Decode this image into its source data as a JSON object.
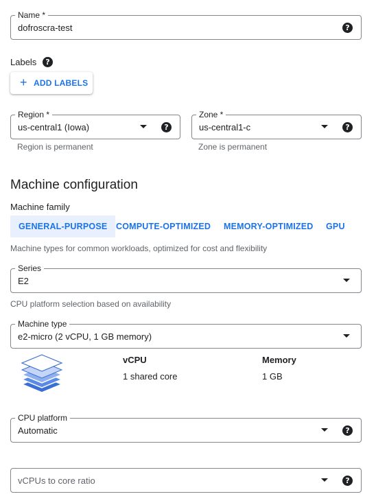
{
  "name_field": {
    "label": "Name *",
    "value": "dofroscra-test",
    "help": "?"
  },
  "labels": {
    "title": "Labels",
    "help": "?",
    "add_button": "ADD LABELS",
    "add_icon": "+"
  },
  "region": {
    "label": "Region *",
    "value": "us-central1 (Iowa)",
    "hint": "Region is permanent",
    "help": "?"
  },
  "zone": {
    "label": "Zone *",
    "value": "us-central1-c",
    "hint": "Zone is permanent",
    "help": "?"
  },
  "machine_config": {
    "title": "Machine configuration",
    "family_label": "Machine family",
    "tabs": [
      {
        "label": "GENERAL-PURPOSE",
        "active": true
      },
      {
        "label": "COMPUTE-OPTIMIZED",
        "active": false
      },
      {
        "label": "MEMORY-OPTIMIZED",
        "active": false
      },
      {
        "label": "GPU",
        "active": false
      }
    ],
    "family_description": "Machine types for common workloads, optimized for cost and flexibility",
    "series": {
      "label": "Series",
      "value": "E2",
      "hint": "CPU platform selection based on availability"
    },
    "machine_type": {
      "label": "Machine type",
      "value": "e2-micro (2 vCPU, 1 GB memory)"
    },
    "specs": {
      "icon": "stacked-layers-icon",
      "vcpu_header": "vCPU",
      "vcpu_value": "1 shared core",
      "memory_header": "Memory",
      "memory_value": "1 GB"
    },
    "cpu_platform": {
      "label": "CPU platform",
      "value": "Automatic",
      "help": "?"
    },
    "vcpu_ratio": {
      "placeholder": "vCPUs to core ratio",
      "help": "?"
    }
  },
  "colors": {
    "accent": "#1a73e8",
    "tab_active_bg": "#e8f0fe",
    "border": "#80868b",
    "hint": "#5f6368"
  }
}
